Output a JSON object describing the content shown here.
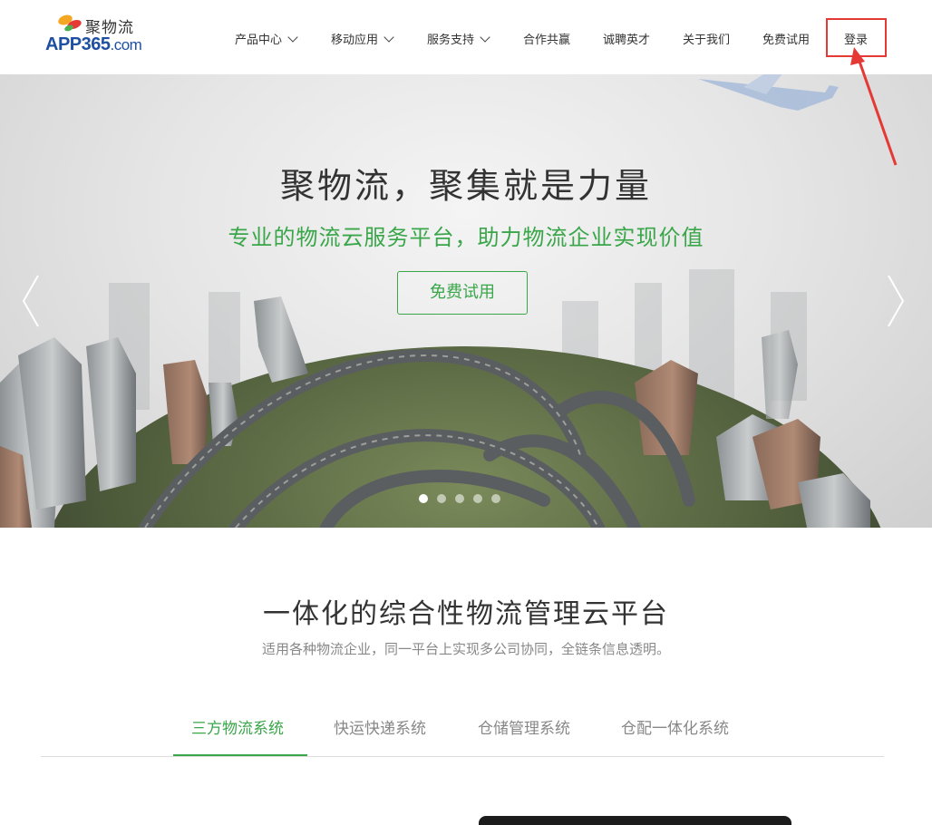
{
  "brand": {
    "name_cn": "聚物流",
    "name_en_main": "APP365",
    "name_en_suffix": ".com"
  },
  "nav": {
    "items": [
      {
        "label": "产品中心",
        "dropdown": true
      },
      {
        "label": "移动应用",
        "dropdown": true
      },
      {
        "label": "服务支持",
        "dropdown": true
      },
      {
        "label": "合作共赢",
        "dropdown": false
      },
      {
        "label": "诚聘英才",
        "dropdown": false
      },
      {
        "label": "关于我们",
        "dropdown": false
      },
      {
        "label": "免费试用",
        "dropdown": false
      },
      {
        "label": "登录",
        "dropdown": false
      }
    ]
  },
  "banner": {
    "title": "聚物流，聚集就是力量",
    "subtitle": "专业的物流云服务平台，助力物流企业实现价值",
    "cta": "免费试用",
    "slide_count": 5,
    "active_slide": 1
  },
  "section": {
    "title": "一体化的综合性物流管理云平台",
    "subtitle": "适用各种物流企业，同一平台上实现多公司协同，全链条信息透明。",
    "tabs": [
      {
        "label": "三方物流系统",
        "active": true
      },
      {
        "label": "快运快递系统",
        "active": false
      },
      {
        "label": "仓储管理系统",
        "active": false
      },
      {
        "label": "仓配一体化系统",
        "active": false
      }
    ]
  },
  "colors": {
    "accent_green": "#3aa64a",
    "brand_blue": "#1e4fa0",
    "highlight_red": "#e53935"
  }
}
